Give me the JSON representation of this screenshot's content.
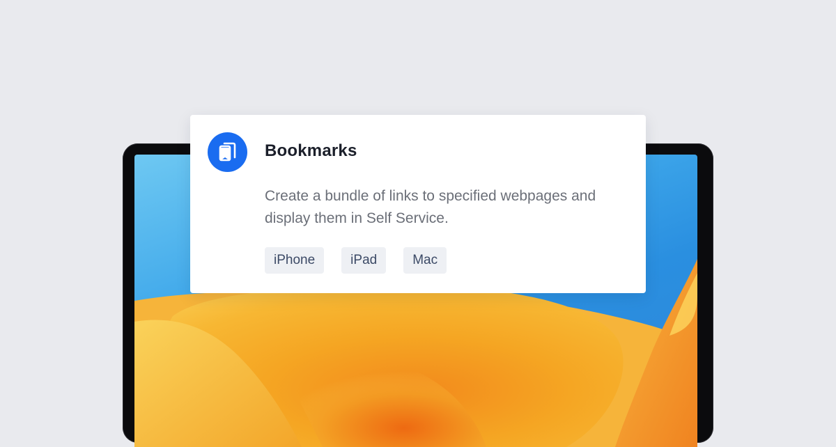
{
  "card": {
    "icon": "bookmark-icon",
    "title": "Bookmarks",
    "description": "Create a bundle of links to specified webpages and display them in Self Service.",
    "tags": [
      "iPhone",
      "iPad",
      "Mac"
    ]
  },
  "colors": {
    "background": "#e9eaee",
    "icon_circle": "#1a6cf0",
    "tag_background": "#eef0f4",
    "tag_text": "#3c4a66",
    "title_text": "#1b1f2a",
    "description_text": "#6b6f78"
  }
}
